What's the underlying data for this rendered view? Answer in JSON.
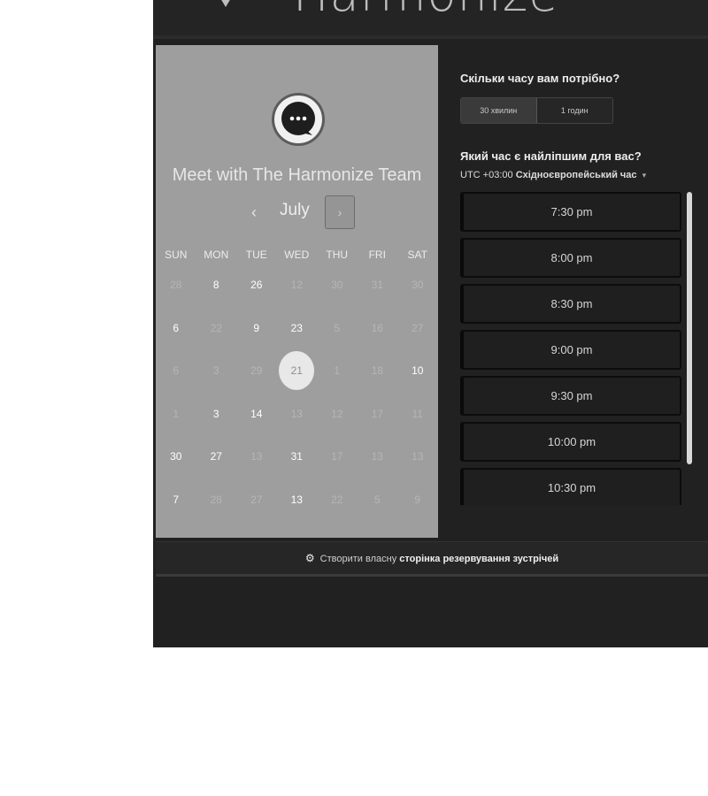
{
  "header": {
    "brand": "Harmonize"
  },
  "left": {
    "title": "Meet with The Harmonize Team",
    "month": "July",
    "prev_label": "‹",
    "next_label": "›",
    "weekdays": [
      "SUN",
      "MON",
      "TUE",
      "WED",
      "THU",
      "FRI",
      "SAT"
    ],
    "rows": [
      [
        {
          "d": "28",
          "m": true
        },
        {
          "d": "8",
          "m": false
        },
        {
          "d": "26",
          "m": false
        },
        {
          "d": "12",
          "m": true
        },
        {
          "d": "30",
          "m": true
        },
        {
          "d": "31",
          "m": true
        },
        {
          "d": "30",
          "m": true
        }
      ],
      [
        {
          "d": "6",
          "m": false
        },
        {
          "d": "22",
          "m": true
        },
        {
          "d": "9",
          "m": false
        },
        {
          "d": "23",
          "m": false
        },
        {
          "d": "5",
          "m": true
        },
        {
          "d": "16",
          "m": true
        },
        {
          "d": "27",
          "m": true
        }
      ],
      [
        {
          "d": "6",
          "m": true
        },
        {
          "d": "3",
          "m": true
        },
        {
          "d": "29",
          "m": true
        },
        {
          "d": "21",
          "m": false,
          "sel": true
        },
        {
          "d": "1",
          "m": true
        },
        {
          "d": "18",
          "m": true
        },
        {
          "d": "10",
          "m": false
        }
      ],
      [
        {
          "d": "1",
          "m": true
        },
        {
          "d": "3",
          "m": false
        },
        {
          "d": "14",
          "m": false
        },
        {
          "d": "13",
          "m": true
        },
        {
          "d": "12",
          "m": true
        },
        {
          "d": "17",
          "m": true
        },
        {
          "d": "11",
          "m": true
        }
      ],
      [
        {
          "d": "30",
          "m": false
        },
        {
          "d": "27",
          "m": false
        },
        {
          "d": "13",
          "m": true
        },
        {
          "d": "31",
          "m": false
        },
        {
          "d": "17",
          "m": true
        },
        {
          "d": "13",
          "m": true
        },
        {
          "d": "13",
          "m": true
        }
      ],
      [
        {
          "d": "7",
          "m": false
        },
        {
          "d": "28",
          "m": true
        },
        {
          "d": "27",
          "m": true
        },
        {
          "d": "13",
          "m": false
        },
        {
          "d": "22",
          "m": true
        },
        {
          "d": "5",
          "m": true
        },
        {
          "d": "9",
          "m": true
        }
      ]
    ]
  },
  "right": {
    "duration_question": "Скільки часу вам потрібно?",
    "duration_options": [
      "30 хвилин",
      "1 годин"
    ],
    "time_question": "Який час є найліпшим для вас?",
    "timezone_offset": "UTC +03:00",
    "timezone_name": "Східноєвропейський час",
    "slots": [
      "7:30 pm",
      "8:00 pm",
      "8:30 pm",
      "9:00 pm",
      "9:30 pm",
      "10:00 pm",
      "10:30 pm"
    ]
  },
  "footer": {
    "prefix": "Створити власну",
    "link": "сторінка резервування зустрічей"
  },
  "colors": {
    "left_panel": "#9e9e9e",
    "background": "#212121",
    "selected_day": "#e8e8e8"
  },
  "icons": {
    "brand": "harmonize-logo-icon",
    "chat": "chat-bubble-icon",
    "footer": "sprocket-icon"
  }
}
